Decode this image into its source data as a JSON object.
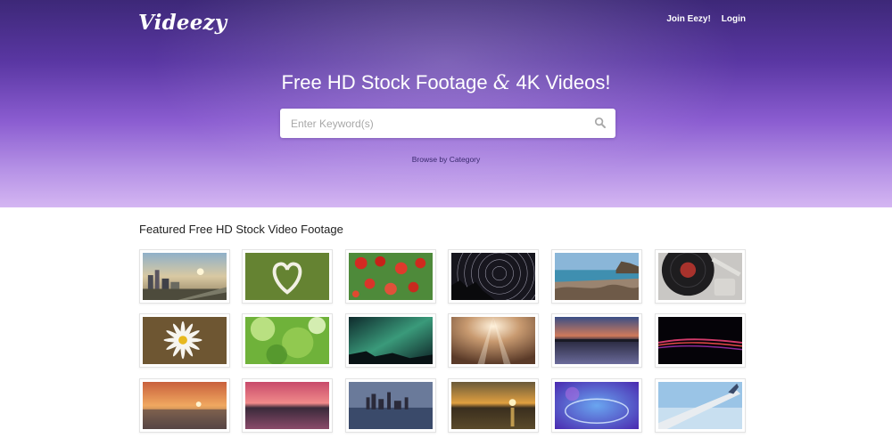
{
  "header": {
    "logo": "Videezy",
    "nav": [
      {
        "label": "Join Eezy!"
      },
      {
        "label": "Login"
      }
    ]
  },
  "hero": {
    "title_part1": "Free HD Stock Footage",
    "title_amp": "&",
    "title_part2": "4K Videos!",
    "search_placeholder": "Enter Keyword(s)",
    "search_value": "",
    "browse_link": "Browse by Category"
  },
  "featured": {
    "title": "Featured Free HD Stock Video Footage"
  },
  "colors": {
    "hero_top": "#3d2878",
    "hero_bottom": "#d4b6f2",
    "link": "#3a2a6e"
  }
}
